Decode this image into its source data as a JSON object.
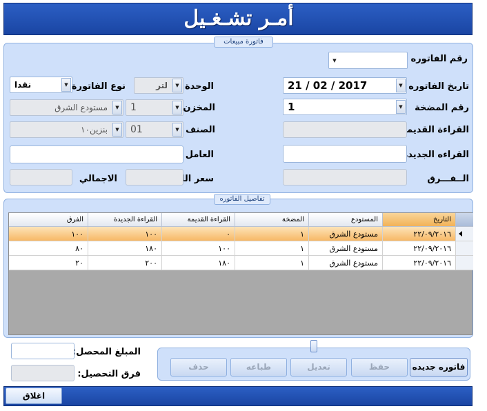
{
  "window": {
    "title": "أمـر تشـغـيل"
  },
  "invoice_group": {
    "legend": "فاتورة مبيعات",
    "invoice_number": {
      "label": "رقم الفاتوره",
      "value": ""
    },
    "invoice_date": {
      "label": "تاريخ الفاتوره",
      "value": "21 / 02 / 2017"
    },
    "pump_number": {
      "label": "رقم المضخة",
      "value": "1"
    },
    "old_reading": {
      "label": "القراءة القديمة",
      "value": ""
    },
    "new_reading": {
      "label": "القراءه الجديدة",
      "value": ""
    },
    "difference": {
      "label": "الــفـــرق",
      "value": ""
    },
    "unit": {
      "label": "الوحدة",
      "value": "لتر"
    },
    "invoice_type": {
      "label": "نوع الفاتورة",
      "value": "نقدا"
    },
    "store": {
      "label": "المخزن",
      "code": "1",
      "name": "مستودع الشرق"
    },
    "item": {
      "label": "الصنف",
      "code": "01",
      "name": "بنزين١٠"
    },
    "worker": {
      "label": "العامل",
      "value": ""
    },
    "liter_price": {
      "label": "سعر اللتر",
      "value": ""
    },
    "total": {
      "label": "الاجمالي",
      "value": ""
    }
  },
  "details_group": {
    "legend": "تفاصيل الفاتوره",
    "columns": [
      "التاريخ",
      "المستودع",
      "المضخة",
      "القراءة القديمة",
      "القراءة الجديدة",
      "الفرق"
    ],
    "rows": [
      [
        "٢٢/٠٩/٢٠١٦",
        "مستودع الشرق",
        "١",
        "٠",
        "١٠٠",
        "١٠٠"
      ],
      [
        "٢٢/٠٩/٢٠١٦",
        "مستودع الشرق",
        "١",
        "١٠٠",
        "١٨٠",
        "٨٠"
      ],
      [
        "٢٢/٠٩/٢٠١٦",
        "مستودع الشرق",
        "١",
        "١٨٠",
        "٢٠٠",
        "٢٠"
      ]
    ]
  },
  "payment": {
    "collected_label": "المبلغ المحصل:",
    "collected_value": "",
    "diff_label": "فرق التحصيل:",
    "diff_value": ""
  },
  "actions": {
    "new_invoice": "فاتوره جديده",
    "save": "حفظ",
    "edit": "تعديل",
    "print": "طباعه",
    "delete": "حذف"
  },
  "footer": {
    "close": "اغلاق"
  },
  "colors": {
    "header": "#1a45a3",
    "panel": "#cfe0fa",
    "row_selected": "#f7b866"
  },
  "icons": {
    "dropdown": "chevron-down-icon",
    "row_pointer": "row-pointer-icon"
  }
}
